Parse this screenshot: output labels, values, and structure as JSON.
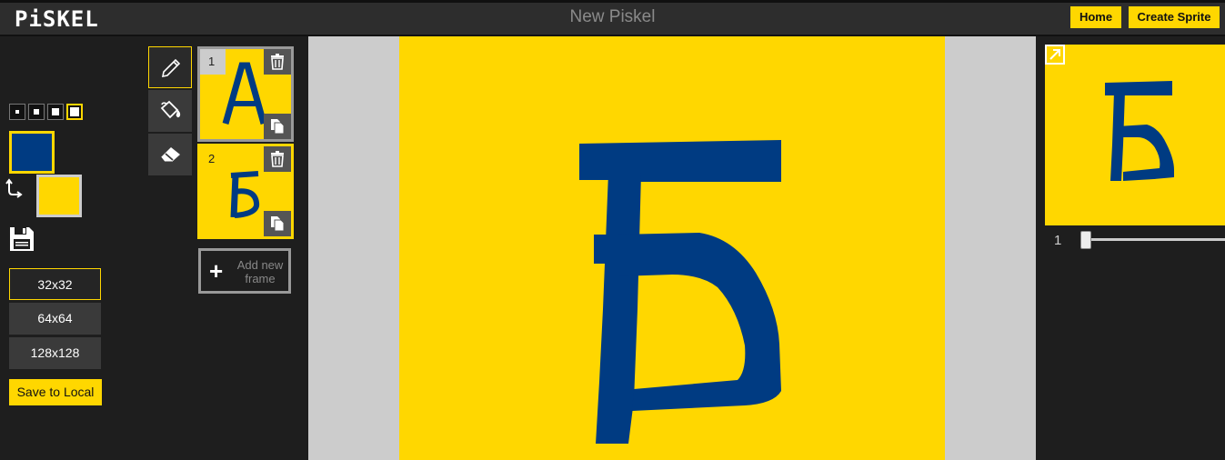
{
  "app": {
    "logo": "PiSKEL",
    "title": "New Piskel"
  },
  "header": {
    "home_label": "Home",
    "create_sprite_label": "Create Sprite"
  },
  "colors": {
    "accent": "#ffd700",
    "primary_color": "#003b82",
    "secondary_color": "#ffd700",
    "canvas_bg": "#cccccc"
  },
  "tools": {
    "pen_sizes": [
      1,
      2,
      3,
      4
    ],
    "selected_pen_size": 4,
    "items": [
      {
        "name": "pen-tool",
        "icon": "pencil-icon",
        "selected": true
      },
      {
        "name": "paint-bucket-tool",
        "icon": "paint-bucket-icon",
        "selected": false
      },
      {
        "name": "eraser-tool",
        "icon": "eraser-icon",
        "selected": false
      }
    ]
  },
  "resolution": {
    "options": [
      "32x32",
      "64x64",
      "128x128"
    ],
    "selected": "32x32",
    "save_label": "Save to Local"
  },
  "frames": {
    "items": [
      {
        "number": "1",
        "content": "А",
        "selected": false
      },
      {
        "number": "2",
        "content": "Б",
        "selected": true
      }
    ],
    "add_label_line1": "Add new",
    "add_label_line2": "frame"
  },
  "canvas": {
    "drawing": "Б"
  },
  "preview": {
    "fps_value": "1"
  }
}
